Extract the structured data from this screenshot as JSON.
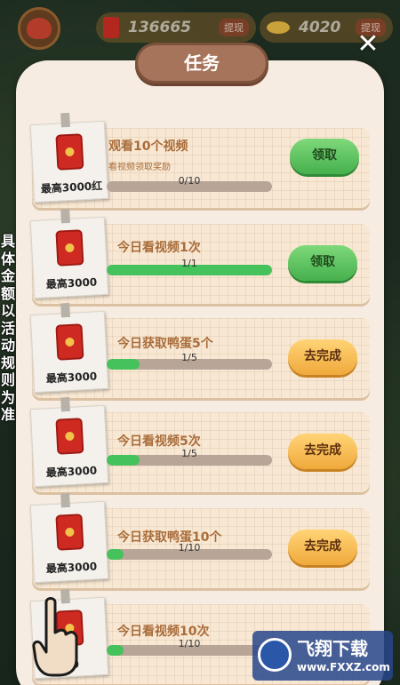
{
  "topbar": {
    "cash": "136665",
    "cash_button": "提现",
    "gold": "4020",
    "gold_button": "提现"
  },
  "panel": {
    "title": "任务"
  },
  "tasks": [
    {
      "reward": "最高3000红",
      "title": "观看10个视频",
      "subtitle": "看视频领取奖励",
      "progress_text": "0/10",
      "progress": 0.0,
      "button": "领取",
      "button_state": "claim"
    },
    {
      "reward": "最高3000",
      "title": "今日看视频1次",
      "subtitle": "",
      "progress_text": "1/1",
      "progress": 1.0,
      "button": "领取",
      "button_state": "claim"
    },
    {
      "reward": "最高3000",
      "title": "今日获取鸭蛋5个",
      "subtitle": "",
      "progress_text": "1/5",
      "progress": 0.2,
      "button": "去完成",
      "button_state": "go"
    },
    {
      "reward": "最高3000",
      "title": "今日看视频5次",
      "subtitle": "",
      "progress_text": "1/5",
      "progress": 0.2,
      "button": "去完成",
      "button_state": "go"
    },
    {
      "reward": "最高3000",
      "title": "今日获取鸭蛋10个",
      "subtitle": "",
      "progress_text": "1/10",
      "progress": 0.1,
      "button": "去完成",
      "button_state": "go"
    },
    {
      "reward": "00",
      "title": "今日看视频10次",
      "subtitle": "",
      "progress_text": "1/10",
      "progress": 0.1,
      "button": "",
      "button_state": "go"
    }
  ],
  "side_note": [
    "具",
    "体",
    "金",
    "额",
    "以",
    "活",
    "动",
    "规",
    "则",
    "为",
    "准"
  ],
  "watermark": {
    "title": "飞翔下载",
    "url": "www.FXXZ.com"
  },
  "colors": {
    "panel": "#f6ece1",
    "claim_button": "#45b14d",
    "go_button": "#f0a93b",
    "progress_fill": "#46c25c",
    "task_text": "#a96c3a"
  }
}
